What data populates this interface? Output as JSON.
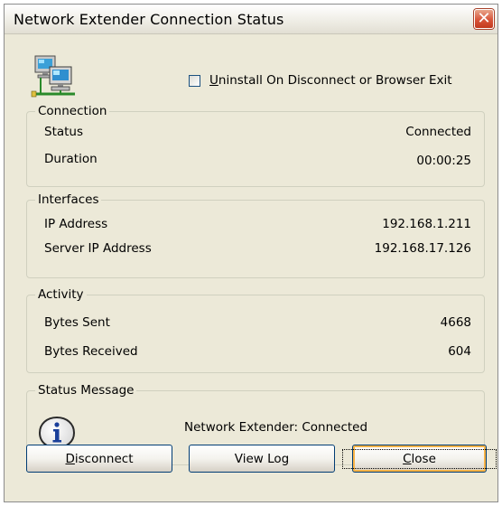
{
  "window": {
    "title": "Network Extender Connection Status",
    "close_glyph": "✕"
  },
  "options": {
    "uninstall_label_accel": "U",
    "uninstall_label_rest": "ninstall On Disconnect or Browser Exit",
    "uninstall_checked": false
  },
  "connection": {
    "legend": "Connection",
    "rows": [
      {
        "label": "Status",
        "value": "Connected"
      },
      {
        "label": "Duration",
        "value": "00:00:25"
      }
    ]
  },
  "interfaces": {
    "legend": "Interfaces",
    "rows": [
      {
        "label": "IP Address",
        "value": "192.168.1.211"
      },
      {
        "label": "Server IP Address",
        "value": "192.168.17.126"
      }
    ]
  },
  "activity": {
    "legend": "Activity",
    "rows": [
      {
        "label": "Bytes Sent",
        "value": "4668"
      },
      {
        "label": "Bytes Received",
        "value": "604"
      }
    ]
  },
  "status_message": {
    "legend": "Status Message",
    "icon": "info-icon",
    "text": "Network Extender: Connected"
  },
  "buttons": {
    "disconnect_accel": "D",
    "disconnect_rest": "isconnect",
    "view_log": "View Log",
    "close_accel": "C",
    "close_rest": "lose"
  },
  "colors": {
    "window_bg": "#ece9d8",
    "close_button": "#d8543a",
    "group_border": "#d0d0bf",
    "button_border": "#003c74",
    "focus_highlight": "#f8b347"
  }
}
